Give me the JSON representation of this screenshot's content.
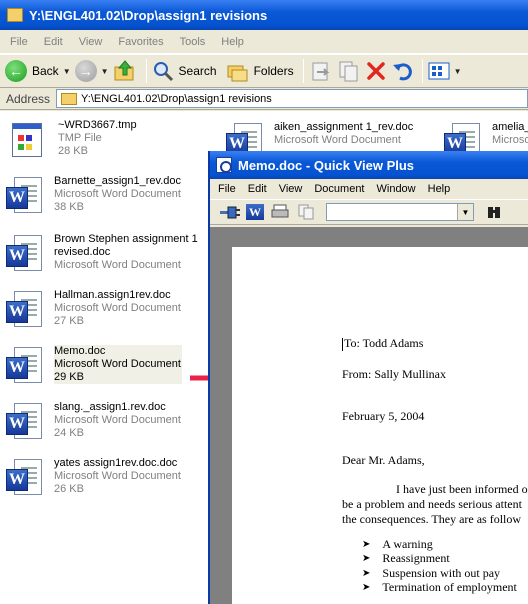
{
  "explorer": {
    "title": "Y:\\ENGL401.02\\Drop\\assign1 revisions",
    "menu": [
      "File",
      "Edit",
      "View",
      "Favorites",
      "Tools",
      "Help"
    ],
    "toolbar": {
      "back": "Back",
      "search": "Search",
      "folders": "Folders"
    },
    "address_label": "Address",
    "address_value": "Y:\\ENGL401.02\\Drop\\assign1 revisions",
    "files": [
      {
        "name": "~WRD3667.tmp",
        "type": "TMP File",
        "size": "28 KB"
      },
      {
        "name": "Barnette_assign1_rev.doc",
        "type": "Microsoft Word Document",
        "size": "38 KB"
      },
      {
        "name": "Brown Stephen assignment 1",
        "name2": "revised.doc",
        "type": "Microsoft Word Document",
        "size": ""
      },
      {
        "name": "Hallman.assign1rev.doc",
        "type": "Microsoft Word Document",
        "size": "27 KB"
      },
      {
        "name": "Memo.doc",
        "type": "Microsoft Word Document",
        "size": "29 KB"
      },
      {
        "name": "slang._assign1.rev.doc",
        "type": "Microsoft Word Document",
        "size": "24 KB"
      },
      {
        "name": "yates assign1rev.doc.doc",
        "type": "Microsoft Word Document",
        "size": "26 KB"
      },
      {
        "name": "aiken_assignment 1_rev.doc",
        "type": "Microsoft Word Document",
        "size": ""
      },
      {
        "name": "amelia_",
        "type": "Microsoft",
        "size": ""
      }
    ]
  },
  "quickview": {
    "title": "Memo.doc - Quick View Plus",
    "menu": [
      "File",
      "Edit",
      "View",
      "Document",
      "Window",
      "Help"
    ],
    "doc": {
      "to": "To: Todd Adams",
      "from": "From: Sally Mullinax",
      "date": "February 5, 2004",
      "salutation": "Dear Mr. Adams,",
      "line1": "I have just been informed of",
      "line2": "be a problem and needs serious attent",
      "line3": "the consequences.  They are as follow",
      "bullets": [
        "A warning",
        "Reassignment",
        "Suspension with out pay",
        "Termination of employment"
      ]
    }
  },
  "colors": {
    "titlebar": "#0553d0",
    "arrow": "#e8234a"
  }
}
